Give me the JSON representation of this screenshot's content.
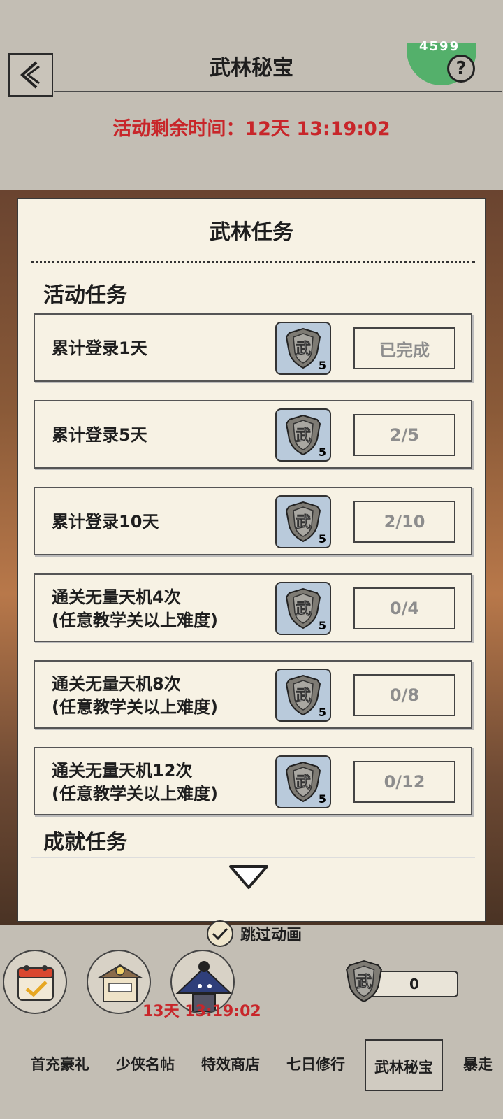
{
  "header": {
    "title": "武林秘宝",
    "badge_text": "4599",
    "help_label": "?",
    "remaining_time": "活动剩余时间：12天 13:19:02"
  },
  "panel": {
    "title": "武林任务",
    "section_activity": "活动任务",
    "section_achievement": "成就任务",
    "tasks": [
      {
        "line1": "累计登录1天",
        "line2": "",
        "reward_qty": "5",
        "status": "已完成"
      },
      {
        "line1": "累计登录5天",
        "line2": "",
        "reward_qty": "5",
        "status": "2/5"
      },
      {
        "line1": "累计登录10天",
        "line2": "",
        "reward_qty": "5",
        "status": "2/10"
      },
      {
        "line1": "通关无量天机4次",
        "line2": "(任意教学关以上难度)",
        "reward_qty": "5",
        "status": "0/4"
      },
      {
        "line1": "通关无量天机8次",
        "line2": "(任意教学关以上难度)",
        "reward_qty": "5",
        "status": "0/8"
      },
      {
        "line1": "通关无量天机12次",
        "line2": "(任意教学关以上难度)",
        "reward_qty": "5",
        "status": "0/12"
      }
    ]
  },
  "skip_animation": "跳过动画",
  "event_countdown": "13天 13:19:02",
  "currency_count": "0",
  "tabs": [
    {
      "label": "首充豪礼"
    },
    {
      "label": "少侠名帖"
    },
    {
      "label": "特效商店"
    },
    {
      "label": "七日修行"
    },
    {
      "label": "武林秘宝"
    },
    {
      "label": "暴走"
    }
  ],
  "active_tab": "武林秘宝",
  "colors": {
    "accent_red": "#c8262a",
    "badge_green": "#54b06b",
    "panel_bg": "#f7f2e4"
  }
}
